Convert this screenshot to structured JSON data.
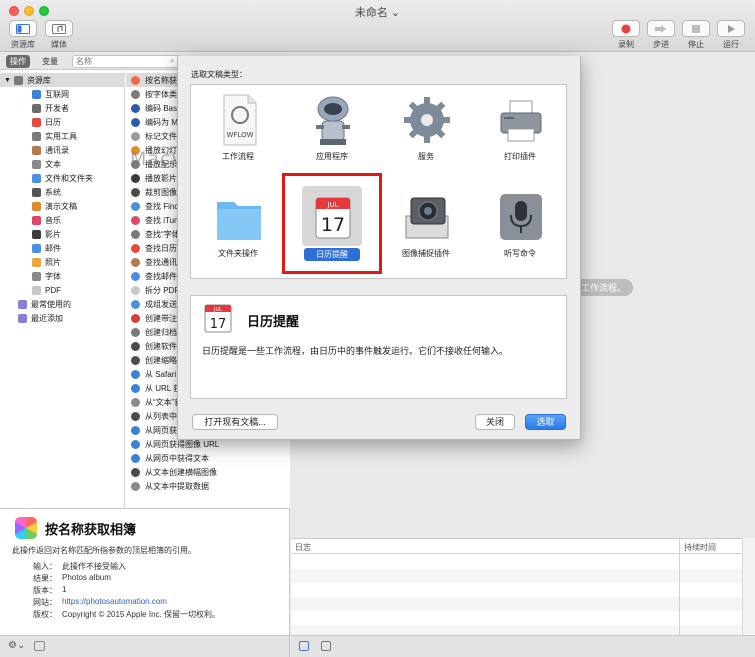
{
  "window": {
    "title": "未命名"
  },
  "toolbar": {
    "library_label": "资源库",
    "media_label": "媒体",
    "record_label": "录制",
    "step_label": "步进",
    "stop_label": "停止",
    "run_label": "运行"
  },
  "sidebar": {
    "tab_actions": "操作",
    "tab_variables": "变量",
    "search_placeholder": "名称",
    "library_root": "资源库",
    "categories": [
      {
        "label": "互联网",
        "icon": "globe-icon",
        "color": "#3b82d6"
      },
      {
        "label": "开发者",
        "icon": "tools-icon",
        "color": "#6b6b6b"
      },
      {
        "label": "日历",
        "icon": "calendar-icon",
        "color": "#e54b3c"
      },
      {
        "label": "实用工具",
        "icon": "wrench-icon",
        "color": "#7a7a7a"
      },
      {
        "label": "通讯录",
        "icon": "contacts-icon",
        "color": "#b07a4a"
      },
      {
        "label": "文本",
        "icon": "text-icon",
        "color": "#8a8a8a"
      },
      {
        "label": "文件和文件夹",
        "icon": "finder-icon",
        "color": "#4a90e2"
      },
      {
        "label": "系统",
        "icon": "system-icon",
        "color": "#555555"
      },
      {
        "label": "演示文稿",
        "icon": "presentation-icon",
        "color": "#e08a2c"
      },
      {
        "label": "音乐",
        "icon": "music-icon",
        "color": "#e2466c"
      },
      {
        "label": "影片",
        "icon": "movie-icon",
        "color": "#3a3a3a"
      },
      {
        "label": "邮件",
        "icon": "mail-icon",
        "color": "#4b8fe2"
      },
      {
        "label": "照片",
        "icon": "photos-icon",
        "color": "#f0a33a"
      },
      {
        "label": "字体",
        "icon": "font-icon",
        "color": "#8a8a8a"
      },
      {
        "label": "PDF",
        "icon": "pdf-icon",
        "color": "#c8c8c8"
      }
    ],
    "smart_groups": [
      {
        "label": "最常使用的",
        "icon": "folder-smart-icon",
        "color": "#8e7dd6"
      },
      {
        "label": "最近添加",
        "icon": "folder-smart-icon",
        "color": "#8e7dd6"
      }
    ],
    "actions": [
      {
        "label": "按名称获取相簿",
        "color": "#f06b4a"
      },
      {
        "label": "按字体类型过滤",
        "color": "#7a7a7a"
      },
      {
        "label": "编码 Base64",
        "color": "#2a5bb0"
      },
      {
        "label": "编码为 MP3",
        "color": "#2a5bb0"
      },
      {
        "label": "标记文件",
        "color": "#9a9a9a"
      },
      {
        "label": "播放幻灯片",
        "color": "#e08a2c"
      },
      {
        "label": "播放配乐",
        "color": "#7a7a7a"
      },
      {
        "label": "播放影片",
        "color": "#3a3a3a"
      },
      {
        "label": "裁剪图像",
        "color": "#4b4b4b"
      },
      {
        "label": "查找 Finder 项目",
        "color": "#4a90e2"
      },
      {
        "label": "查找 iTunes 项目",
        "color": "#e2466c"
      },
      {
        "label": "查找“字体书”项目",
        "color": "#7a7a7a"
      },
      {
        "label": "查找日历事件",
        "color": "#e54b3c"
      },
      {
        "label": "查找通讯录中的人",
        "color": "#b07a4a"
      },
      {
        "label": "查找邮件项目",
        "color": "#4b8fe2"
      },
      {
        "label": "拆分 PDF",
        "color": "#c8c8c8"
      },
      {
        "label": "成组发送邮件",
        "color": "#4b8fe2"
      },
      {
        "label": "创建带注释的 PDF",
        "color": "#d63c3c"
      },
      {
        "label": "创建归档",
        "color": "#7a7a7a"
      },
      {
        "label": "创建软件包",
        "color": "#4b4b4b"
      },
      {
        "label": "创建缩略图",
        "color": "#4b4b4b"
      },
      {
        "label": "从 Safari 获取",
        "color": "#3b82d6"
      },
      {
        "label": "从 URL 获取",
        "color": "#3b82d6"
      },
      {
        "label": "从“文本”获取",
        "color": "#8a8a8a"
      },
      {
        "label": "从列表中选择",
        "color": "#4b4b4b"
      },
      {
        "label": "从网页获得链接 URL",
        "color": "#3b82d6"
      },
      {
        "label": "从网页获得图像 URL",
        "color": "#3b82d6"
      },
      {
        "label": "从网页中获得文本",
        "color": "#3b82d6"
      },
      {
        "label": "从文本创建横幅图像",
        "color": "#4b4b4b"
      },
      {
        "label": "从文本中提取数据",
        "color": "#8a8a8a"
      }
    ]
  },
  "description": {
    "title": "按名称获取相簿",
    "summary": "此操作返回对名称匹配所指参数的顶层相簿的引用。",
    "fields": [
      {
        "key": "输入：",
        "value": "此操作不接受输入",
        "link": false
      },
      {
        "key": "结果：",
        "value": "Photos album",
        "link": false
      },
      {
        "key": "版本：",
        "value": "1",
        "link": false
      },
      {
        "key": "网站：",
        "value": "https://photosautomation.com",
        "link": true
      },
      {
        "key": "版权：",
        "value": "Copyright © 2015 Apple Inc. 保留一切权利。",
        "link": false
      }
    ]
  },
  "workflow": {
    "hint_fragment": "工作流程。"
  },
  "log": {
    "col_log": "日志",
    "col_duration": "持续时间"
  },
  "sheet": {
    "title": "选取文稿类型：",
    "types": [
      {
        "label": "工作流程",
        "icon": "workflow-document-icon"
      },
      {
        "label": "应用程序",
        "icon": "automator-robot-icon"
      },
      {
        "label": "服务",
        "icon": "gear-icon"
      },
      {
        "label": "打印插件",
        "icon": "printer-icon"
      },
      {
        "label": "文件夹操作",
        "icon": "folder-icon"
      },
      {
        "label": "日历提醒",
        "icon": "calendar-icon"
      },
      {
        "label": "图像捕捉插件",
        "icon": "camera-icon"
      },
      {
        "label": "听写命令",
        "icon": "microphone-icon"
      }
    ],
    "selected_index": 5,
    "calendar_month": "JUL",
    "calendar_day": "17",
    "workflow_doc_text": "WFLOW",
    "info_title": "日历提醒",
    "info_desc": "日历提醒是一些工作流程，由日历中的事件触发运行。它们不接收任何输入。",
    "open_existing_label": "打开现有文稿...",
    "close_label": "关闭",
    "choose_label": "选取"
  },
  "watermark": "Macv.com"
}
